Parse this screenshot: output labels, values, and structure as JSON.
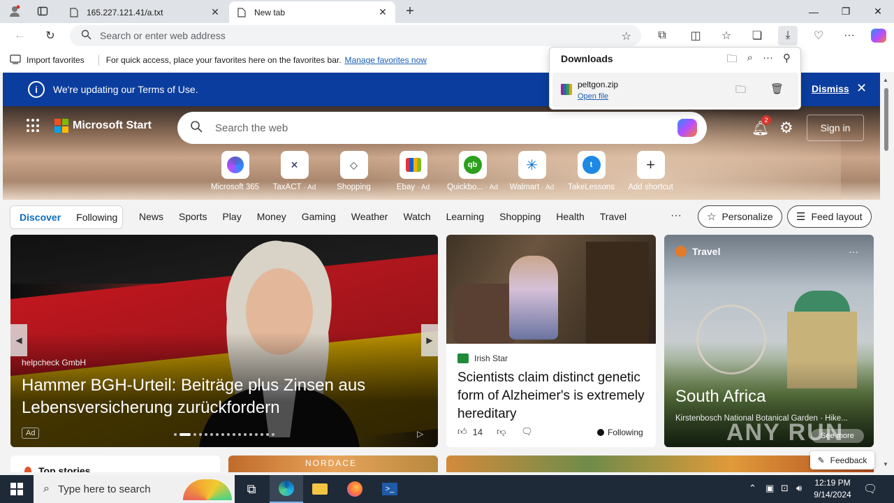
{
  "browser": {
    "tabs": [
      {
        "title": "165.227.121.41/a.txt",
        "active": false
      },
      {
        "title": "New tab",
        "active": true
      }
    ],
    "address_placeholder": "Search or enter web address",
    "favorites_bar": {
      "import_label": "Import favorites",
      "hint": "For quick access, place your favorites here on the favorites bar.",
      "manage_link": "Manage favorites now"
    }
  },
  "downloads": {
    "title": "Downloads",
    "item": {
      "filename": "peltgon.zip",
      "action": "Open file"
    }
  },
  "banner": {
    "text": "We're updating our Terms of Use.",
    "dismiss": "Dismiss"
  },
  "start": {
    "brand": "Microsoft Start",
    "search_placeholder": "Search the web",
    "notifications_count": "2",
    "sign_in": "Sign in",
    "shortcuts": [
      {
        "label": "Microsoft 365",
        "ad": "",
        "icon": "m365-icon"
      },
      {
        "label": "TaxACT",
        "ad": "· Ad",
        "icon": "taxact-icon"
      },
      {
        "label": "Shopping",
        "ad": "",
        "icon": "shopping-tag-icon"
      },
      {
        "label": "Ebay",
        "ad": "· Ad",
        "icon": "ebay-icon"
      },
      {
        "label": "Quickbo...",
        "ad": "· Ad",
        "icon": "quickbooks-icon"
      },
      {
        "label": "Walmart",
        "ad": "· Ad",
        "icon": "walmart-icon"
      },
      {
        "label": "TakeLessons",
        "ad": "",
        "icon": "takelessons-icon"
      },
      {
        "label": "Add shortcut",
        "ad": "",
        "icon": "plus-icon"
      }
    ]
  },
  "nav": {
    "discover": "Discover",
    "following": "Following",
    "categories": [
      "News",
      "Sports",
      "Play",
      "Money",
      "Gaming",
      "Weather",
      "Watch",
      "Learning",
      "Shopping",
      "Health",
      "Travel"
    ],
    "more": "···",
    "personalize": "Personalize",
    "feed_layout": "Feed layout"
  },
  "cards": {
    "hero": {
      "source": "helpcheck GmbH",
      "headline": "Hammer BGH-Urteil: Beiträge plus Zinsen aus Lebensversicherung zurückfordern",
      "ad_label": "Ad"
    },
    "news": {
      "source": "Irish Star",
      "title": "Scientists claim distinct genetic form of Alzheimer's is extremely hereditary",
      "likes": "14",
      "following": "Following"
    },
    "travel": {
      "category": "Travel",
      "place": "South Africa",
      "subtitle": "Kirstenbosch National Botanical Garden · Hike...",
      "see_more": "See more"
    },
    "row2": {
      "top_stories": "Top stories",
      "brand": "NORDACE"
    }
  },
  "feedback": "Feedback",
  "watermark": "ANY RUN",
  "taskbar": {
    "search_placeholder": "Type here to search",
    "time": "12:19 PM",
    "date": "9/14/2024"
  }
}
